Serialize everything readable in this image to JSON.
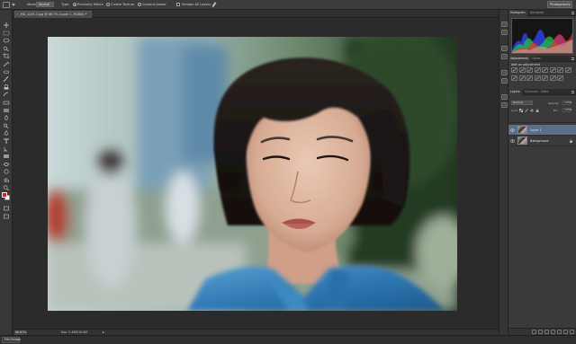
{
  "options_bar": {
    "mode_label": "Mode:",
    "mode_value": "Normal",
    "type_label": "Type:",
    "type_options": [
      "Proximity Match",
      "Create Texture",
      "Content-Aware"
    ],
    "type_selected": "Proximity Match",
    "sample_all_layers": "Sample All Layers",
    "workspace": "Photography"
  },
  "document": {
    "tab_title": "_MG_1235-3.jpg @ 66.7% (Layer 1, RGB/8) *",
    "tab_close": "×"
  },
  "status_bar": {
    "zoom": "66.67%",
    "doc_size": "Doc: 5.49M/10.9M",
    "mini_bridge": "Mini Bridge"
  },
  "panels": {
    "histogram_tabs": [
      "Histogram",
      "Navigator"
    ],
    "adjustments_tabs": [
      "Adjustments",
      "Styles"
    ],
    "adjustments_title": "Add an adjustment",
    "layers_tabs": [
      "Layers",
      "Channels",
      "Paths"
    ],
    "blend_mode": "Normal",
    "opacity_label": "Opacity:",
    "opacity_value": "100%",
    "lock_label": "Lock:",
    "fill_label": "Fill:",
    "fill_value": "100%",
    "layers": [
      {
        "name": "Layer 1",
        "selected": true,
        "italic": false
      },
      {
        "name": "Background",
        "selected": false,
        "italic": true
      }
    ]
  },
  "icons": {
    "tools": [
      "move-icon",
      "marquee-icon",
      "lasso-icon",
      "quick-select-icon",
      "crop-icon",
      "eyedropper-icon",
      "healing-brush-icon",
      "brush-icon",
      "clone-stamp-icon",
      "history-brush-icon",
      "eraser-icon",
      "gradient-icon",
      "blur-icon",
      "dodge-icon",
      "pen-icon",
      "type-icon",
      "path-select-icon",
      "shape-icon",
      "3d-rotate-icon",
      "3d-orbit-icon",
      "hand-icon",
      "zoom-icon"
    ],
    "dock": [
      "history-icon",
      "actions-icon",
      "brush-presets-icon",
      "clone-source-icon",
      "character-icon",
      "paragraph-icon",
      "info-icon",
      "notes-icon"
    ]
  },
  "colors": {
    "foreground": "#e02020",
    "background": "#ffffff",
    "selection": "#5a6f8a"
  }
}
